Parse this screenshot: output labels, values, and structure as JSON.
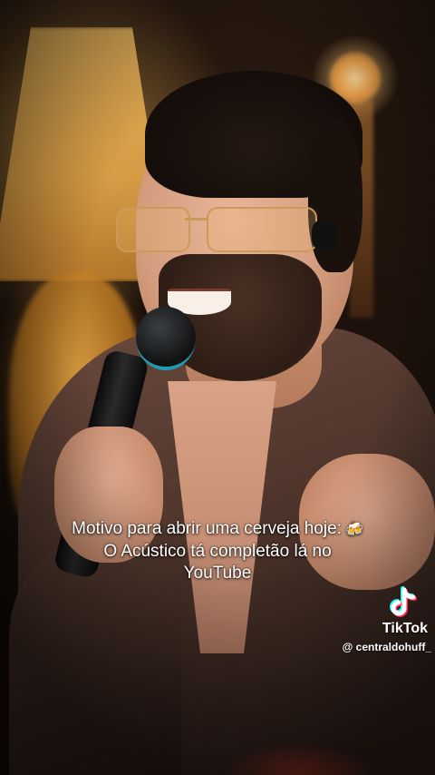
{
  "video": {
    "caption": {
      "line1": "Motivo para abrir uma cerveja hoje:",
      "emoji": "beer-mugs-icon",
      "line2": "O Acústico tá completão lá no",
      "line3": "YouTube"
    }
  },
  "watermark": {
    "logo_icon": "tiktok-logo-icon",
    "brand": "TikTok",
    "handle": "@ centraldohuff_"
  },
  "colors": {
    "caption_text": "#ffffff",
    "tiktok_cyan": "#25F4EE",
    "tiktok_red": "#FE2C55",
    "mic_accent": "#1f9bb8",
    "lamp_glow": "#f6c062"
  }
}
